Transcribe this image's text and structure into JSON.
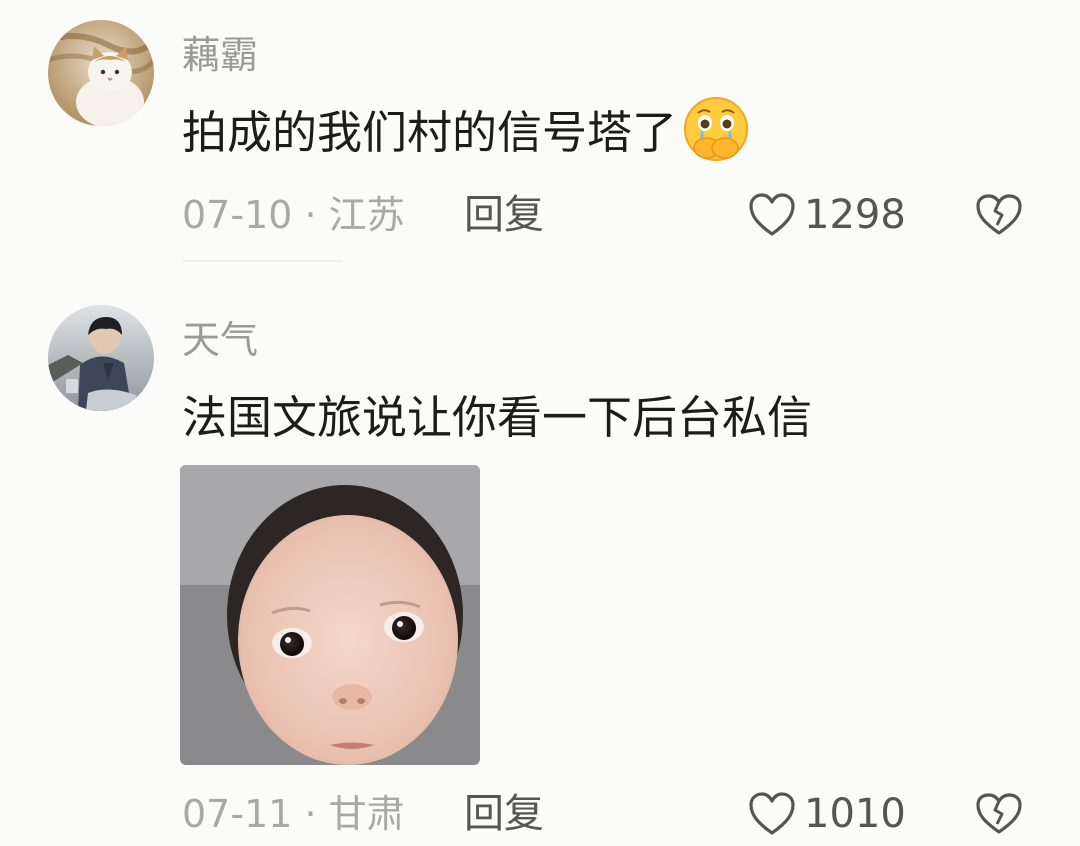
{
  "comments": [
    {
      "username": "藕霸",
      "text": "拍成的我们村的信号塔了",
      "emoji": "😭",
      "date": "07-10",
      "separator": " · ",
      "location": "江苏",
      "reply_label": "回复",
      "likes": "1298",
      "avatar_icon": "cat-avatar",
      "emoji_icon": "crying-face-hands-over-mouth-emoji"
    },
    {
      "username": "天气",
      "text": "法国文旅说让你看一下后台私信",
      "date": "07-11",
      "separator": " · ",
      "location": "甘肃",
      "reply_label": "回复",
      "likes": "1010",
      "avatar_icon": "person-sitting-avatar",
      "sticker_icon": "baby-face-sticker"
    }
  ],
  "colors": {
    "background": "#fbfbf9",
    "username": "#9a9a9a",
    "content": "#1c1c1c",
    "meta": "#a8a8a8",
    "action": "#555555"
  }
}
